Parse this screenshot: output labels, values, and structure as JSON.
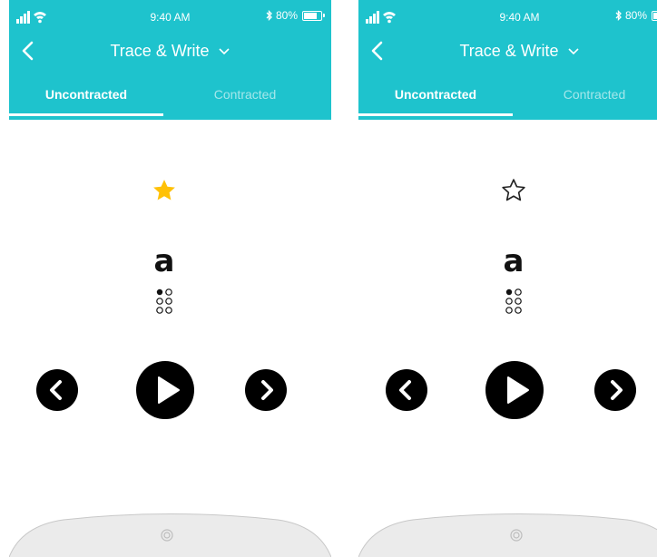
{
  "status": {
    "time": "9:40 AM",
    "battery": "80%",
    "battery_level": 0.8
  },
  "header": {
    "title": "Trace & Write"
  },
  "tabs": [
    {
      "label": "Uncontracted",
      "active": true
    },
    {
      "label": "Contracted",
      "active": false
    }
  ],
  "screens": [
    {
      "favorited": true,
      "letter": "a",
      "braille_dots": [
        1
      ]
    },
    {
      "favorited": false,
      "letter": "a",
      "braille_dots": [
        1
      ]
    }
  ],
  "colors": {
    "header": "#1ec3cd",
    "star_filled": "#ffc107",
    "button": "#000000"
  }
}
